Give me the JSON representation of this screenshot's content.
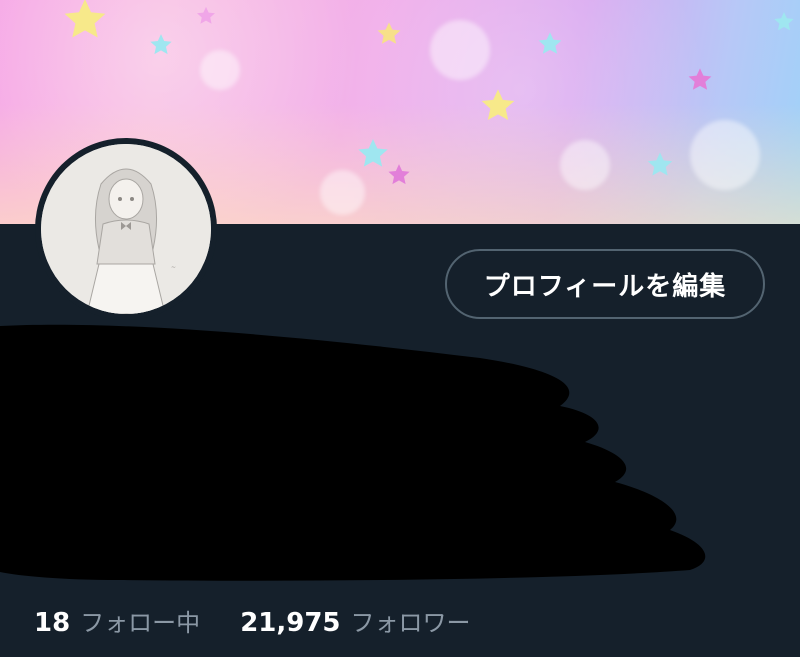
{
  "profile": {
    "edit_button_label": "プロフィールを編集"
  },
  "stats": {
    "following_count": "18",
    "following_label": "フォロー中",
    "followers_count": "21,975",
    "followers_label": "フォロワー"
  },
  "colors": {
    "background": "#15202b",
    "button_border": "#536471",
    "secondary_text": "#8b98a5",
    "primary_text": "#ffffff"
  },
  "icons": {
    "banner": "pastel-stars-banner",
    "avatar": "illustrated-girl-avatar"
  }
}
